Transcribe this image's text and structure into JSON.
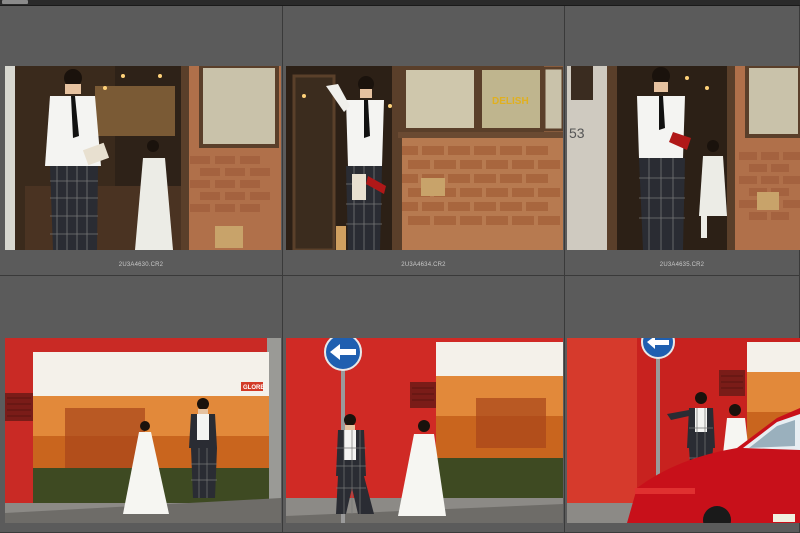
{
  "grid": {
    "cells": [
      {
        "filename": "2U3A4630.CR2"
      },
      {
        "filename": "2U3A4634.CR2"
      },
      {
        "filename": "2U3A4635.CR2"
      },
      {
        "filename": ""
      },
      {
        "filename": ""
      },
      {
        "filename": ""
      }
    ]
  },
  "photos": {
    "shop_sign": "DELISH",
    "address_number": "53",
    "poster_brand": "GLORE"
  }
}
